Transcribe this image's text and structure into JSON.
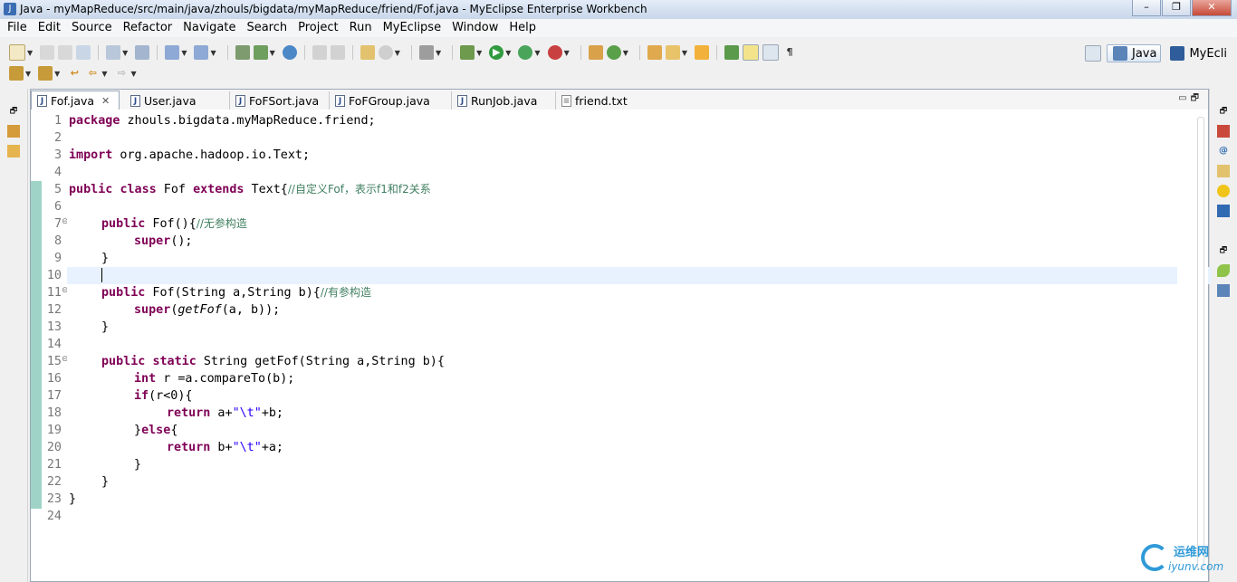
{
  "window": {
    "title": "Java - myMapReduce/src/main/java/zhouls/bigdata/myMapReduce/friend/Fof.java - MyEclipse Enterprise Workbench",
    "minimize": "–",
    "maximize": "❐",
    "close": "✕"
  },
  "menu": [
    "File",
    "Edit",
    "Source",
    "Refactor",
    "Navigate",
    "Search",
    "Project",
    "Run",
    "MyEclipse",
    "Window",
    "Help"
  ],
  "perspectives": {
    "java": "Java",
    "myeclipse": "MyEcli"
  },
  "tabs": [
    {
      "label": "Fof.java",
      "icon": "java-file-icon",
      "active": true
    },
    {
      "label": "User.java",
      "icon": "java-file-icon"
    },
    {
      "label": "FoFSort.java",
      "icon": "java-file-icon"
    },
    {
      "label": "FoFGroup.java",
      "icon": "java-file-icon"
    },
    {
      "label": "RunJob.java",
      "icon": "java-file-icon"
    },
    {
      "label": "friend.txt",
      "icon": "text-file-icon"
    }
  ],
  "code": {
    "line_numbers": [
      "1",
      "2",
      "3",
      "4",
      "5",
      "6",
      "7",
      "8",
      "9",
      "10",
      "11",
      "12",
      "13",
      "14",
      "15",
      "16",
      "17",
      "18",
      "19",
      "20",
      "21",
      "22",
      "23",
      "24"
    ],
    "l1_kw": "package",
    "l1_rest": " zhouls.bigdata.myMapReduce.friend;",
    "l3_kw": "import",
    "l3_rest": " org.apache.hadoop.io.Text;",
    "l5_kw1": "public",
    "l5_kw2": "class",
    "l5_name": " Fof ",
    "l5_kw3": "extends",
    "l5_rest": " Text{",
    "l5_comment": "//自定义Fof，表示f1和f2关系",
    "l7_kw": "public",
    "l7_rest": " Fof(){",
    "l7_comment": "//无参构造",
    "l8_kw": "super",
    "l8_rest": "();",
    "l9": "}",
    "l11_kw": "public",
    "l11_rest": " Fof(String a,String b){",
    "l11_comment": "//有参构造",
    "l12_kw": "super",
    "l12_open": "(",
    "l12_it": "getFof",
    "l12_rest": "(a, b));",
    "l13": "}",
    "l15_kw1": "public",
    "l15_kw2": "static",
    "l15_rest": " String getFof(String a,String b){",
    "l16_kw": "int",
    "l16_rest": " r =a.compareTo(b);",
    "l17_kw": "if",
    "l17_rest": "(r<0){",
    "l18_kw": "return",
    "l18_a": " a+",
    "l18_str": "\"\\t\"",
    "l18_b": "+b;",
    "l19_open": "}",
    "l19_kw": "else",
    "l19_close": "{",
    "l20_kw": "return",
    "l20_a": " b+",
    "l20_str": "\"\\t\"",
    "l20_b": "+a;",
    "l21": "}",
    "l22": "}",
    "l23": "}"
  },
  "watermark": {
    "top": "运维网",
    "bottom": "iyunv.com"
  },
  "colors": {
    "keyword": "#7f0055",
    "comment": "#3f7f5f",
    "string": "#2a00ff",
    "change_bar": "#9fd3c7"
  }
}
